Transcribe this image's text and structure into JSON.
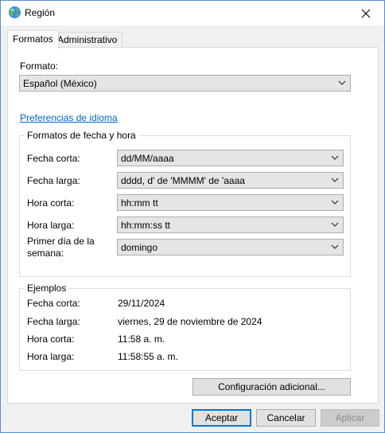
{
  "window": {
    "title": "Región"
  },
  "tabs": [
    {
      "label": "Formatos"
    },
    {
      "label": "Administrativo"
    }
  ],
  "formats": {
    "format_label": "Formato:",
    "format_value": "Español (México)",
    "language_prefs_link": "Preferencias de idioma",
    "datetime_group": {
      "title": "Formatos de fecha y hora",
      "rows": [
        {
          "label": "Fecha corta:",
          "value": "dd/MM/aaaa"
        },
        {
          "label": "Fecha larga:",
          "value": "dddd, d' de 'MMMM' de 'aaaa"
        },
        {
          "label": "Hora corta:",
          "value": "hh:mm tt"
        },
        {
          "label": "Hora larga:",
          "value": "hh:mm:ss tt"
        }
      ],
      "first_day_label_1": "Primer día de la",
      "first_day_label_2": "semana:",
      "first_day_value": "domingo"
    },
    "examples_group": {
      "title": "Ejemplos",
      "rows": [
        {
          "label": "Fecha corta:",
          "value": "29/11/2024"
        },
        {
          "label": "Fecha larga:",
          "value": "viernes, 29 de noviembre de 2024"
        },
        {
          "label": "Hora corta:",
          "value": "11:58 a. m."
        },
        {
          "label": "Hora larga:",
          "value": "11:58:55 a. m."
        }
      ]
    },
    "additional_settings_button": "Configuración adicional..."
  },
  "footer": {
    "ok": "Aceptar",
    "cancel": "Cancelar",
    "apply": "Aplicar"
  }
}
